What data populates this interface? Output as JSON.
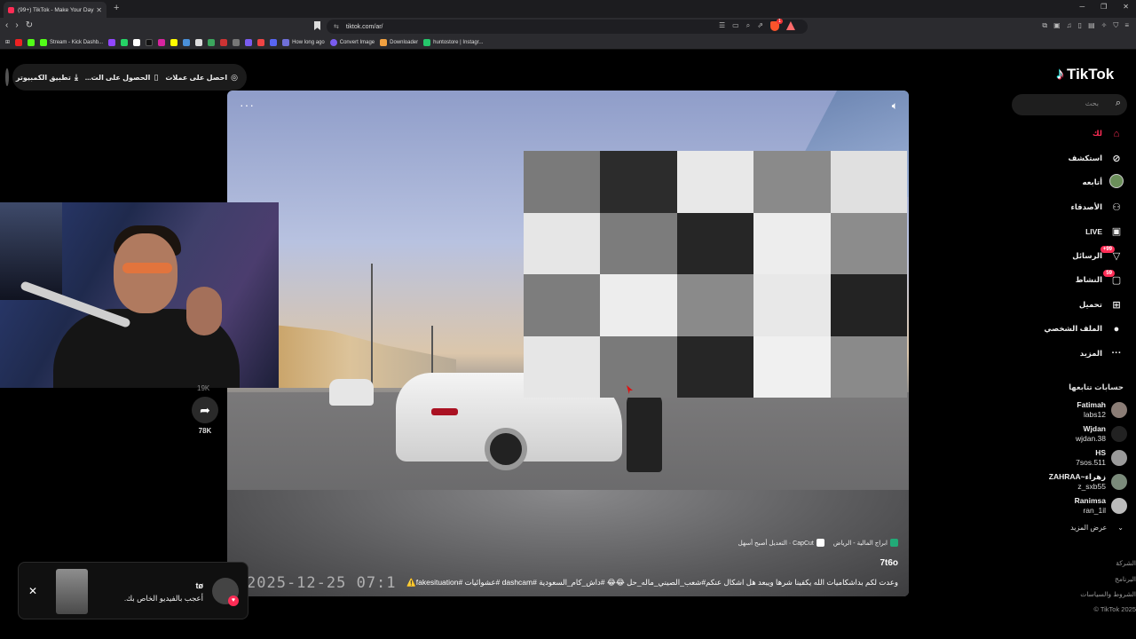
{
  "browser": {
    "tab_title": "(99+) TikTok - Make Your Day",
    "url": "tiktok.com/ar/",
    "bookmarks": [
      {
        "label": "Stream - Kick Dashb...",
        "color": "#53fc18"
      },
      {
        "label": "How long ago",
        "color": "#6f6fd8"
      },
      {
        "label": "Convert Image",
        "color": "#7a5cf0"
      },
      {
        "label": "Downloader",
        "color": "#f0a040"
      },
      {
        "label": "huntostore | Instagr...",
        "color": "#25c76b"
      }
    ],
    "shields_badge": "1"
  },
  "topbar": {
    "get_coins": "احصل على عملات",
    "get_app": "الحصول على الت...",
    "pc_app": "تطبيق الكمبيوتر"
  },
  "sidebar": {
    "logo": "TikTok",
    "search_placeholder": "بحث",
    "nav": [
      {
        "label": "لك",
        "icon": "home-icon"
      },
      {
        "label": "استكشف",
        "icon": "compass-icon"
      },
      {
        "label": "أتابعه",
        "icon": "following-avatar"
      },
      {
        "label": "الأصدقاء",
        "icon": "friends-icon"
      },
      {
        "label": "LIVE",
        "icon": "live-icon"
      },
      {
        "label": "الرسائل",
        "icon": "messages-icon",
        "badge": "+99"
      },
      {
        "label": "النشاط",
        "icon": "activity-icon",
        "badge": "59"
      },
      {
        "label": "تحميل",
        "icon": "upload-icon"
      },
      {
        "label": "الملف الشخصي",
        "icon": "profile-icon"
      },
      {
        "label": "المزيد",
        "icon": "more-icon"
      }
    ],
    "following_title": "حسابات تتابعها",
    "following": [
      {
        "name": "Fatimah",
        "username": "labs12"
      },
      {
        "name": "Wjdan",
        "username": "wjdan.38"
      },
      {
        "name": "HS",
        "username": "7sos.511"
      },
      {
        "name": "ZAHRAA~زهراء",
        "username": "z_sxb55"
      },
      {
        "name": "Ranimsa",
        "username": "ran_1il"
      }
    ],
    "show_more": "عرض المزيد",
    "footer": [
      "الشركة",
      "البرنامج",
      "الشروط والسياسات",
      "© TikTok 2025"
    ]
  },
  "video": {
    "location": "ابراج المالية - الرياض",
    "editor": "CapCut · التعديل أصبح أسهل",
    "author": "7t6o",
    "caption": "وعدت لكم بداشكاميات الله يكفينا شرها ويبعد هل اشكال عنكم#شعب_الصيني_ماله_حل 😂😂 #داش_كام_السعودية #dashcam #عشوائيات #fakesituation⚠️",
    "overlay_timestamp": "2025-12-25  07:1",
    "mosaic_colors": [
      "#7a7a7a",
      "#2c2c2c",
      "#e8e8e8",
      "#8a8a8a",
      "#e0e0e0",
      "#e6e6e6",
      "#7c7c7c",
      "#262626",
      "#ededed",
      "#8c8c8c",
      "#7d7d7d",
      "#ededed",
      "#8a8a8a",
      "#e8e8e8",
      "#232323",
      "#e6e6e6",
      "#7a7a7a",
      "#262626",
      "#f0f0f0",
      "#8a8a8a"
    ]
  },
  "actions": {
    "share_count": "78K",
    "prev_count": "19K"
  },
  "toast": {
    "username": "tø",
    "message": "أعجب بالفيديو الخاص بك."
  }
}
